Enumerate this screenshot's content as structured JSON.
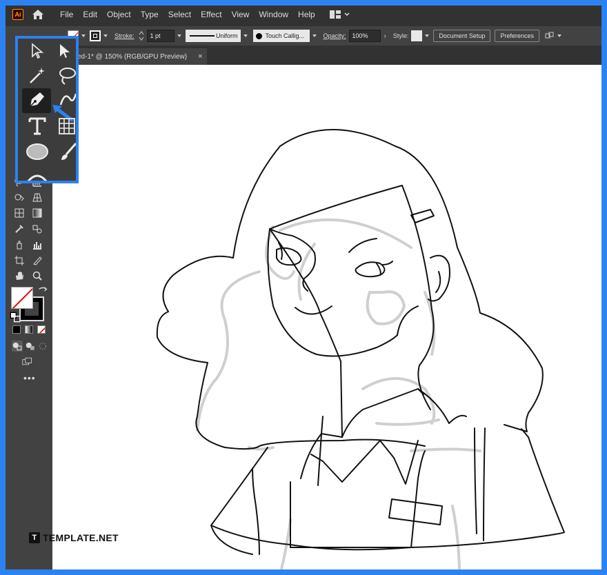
{
  "app": {
    "logo_text": "Ai",
    "menu": [
      "File",
      "Edit",
      "Object",
      "Type",
      "Select",
      "Effect",
      "View",
      "Window",
      "Help"
    ]
  },
  "control_bar": {
    "stroke_label": "Stroke:",
    "stroke_value": "1 pt",
    "profile_label": "Uniform",
    "brush_label": "Touch Callig...",
    "opacity_label": "Opacity:",
    "opacity_value": "100%",
    "style_label": "Style:",
    "document_setup_label": "Document Setup",
    "preferences_label": "Preferences"
  },
  "document_tab": {
    "title": "ed-1* @ 150% (RGB/GPU Preview)",
    "close": "×"
  },
  "colors": {
    "highlight": "#2b82f0",
    "ui_dark": "#323232",
    "ui_panel": "#424242"
  },
  "selected_tool": "pen-tool",
  "watermark": {
    "icon": "T",
    "text": "TEMPLATE.NET"
  }
}
